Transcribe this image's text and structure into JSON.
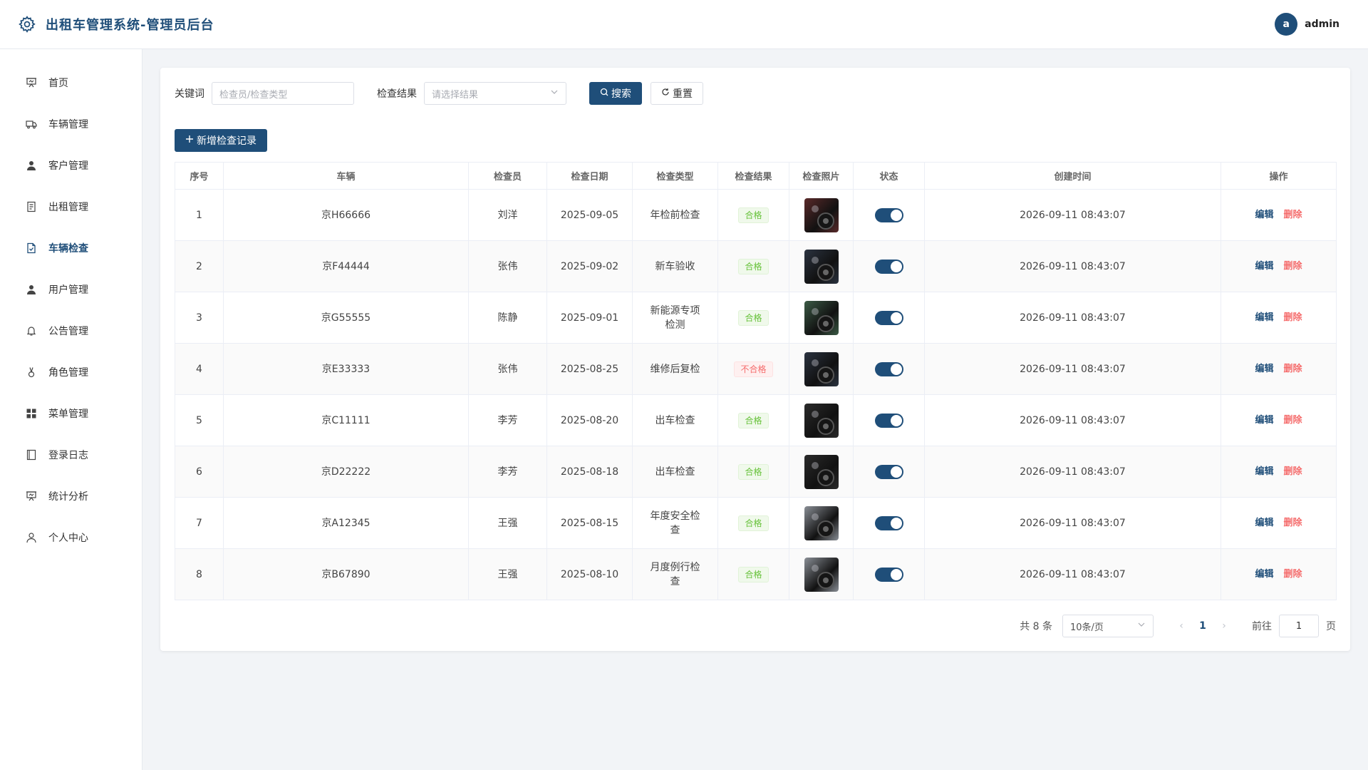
{
  "app": {
    "title": "出租车管理系统-管理员后台",
    "user_initial": "a",
    "username": "admin"
  },
  "sidebar": {
    "items": [
      {
        "label": "首页",
        "icon": "presentation-icon",
        "active": false
      },
      {
        "label": "车辆管理",
        "icon": "truck-icon",
        "active": false
      },
      {
        "label": "客户管理",
        "icon": "user-filled-icon",
        "active": false
      },
      {
        "label": "出租管理",
        "icon": "document-icon",
        "active": false
      },
      {
        "label": "车辆检查",
        "icon": "document-checked-icon",
        "active": true
      },
      {
        "label": "用户管理",
        "icon": "user-filled-icon",
        "active": false
      },
      {
        "label": "公告管理",
        "icon": "bell-icon",
        "active": false
      },
      {
        "label": "角色管理",
        "icon": "medal-icon",
        "active": false
      },
      {
        "label": "菜单管理",
        "icon": "grid-icon",
        "active": false
      },
      {
        "label": "登录日志",
        "icon": "notebook-icon",
        "active": false
      },
      {
        "label": "统计分析",
        "icon": "presentation-icon",
        "active": false
      },
      {
        "label": "个人中心",
        "icon": "user-outline-icon",
        "active": false
      }
    ]
  },
  "filters": {
    "keyword_label": "关键词",
    "keyword_placeholder": "检查员/检查类型",
    "result_label": "检查结果",
    "result_placeholder": "请选择结果",
    "search_label": "搜索",
    "reset_label": "重置",
    "add_label": "新增检查记录"
  },
  "table": {
    "headers": [
      "序号",
      "车辆",
      "检查员",
      "检查日期",
      "检查类型",
      "检查结果",
      "检查照片",
      "状态",
      "创建时间",
      "操作"
    ],
    "rows": [
      {
        "no": "1",
        "vehicle": "京H66666",
        "inspector": "刘洋",
        "date": "2025-09-05",
        "type": "年检前检查",
        "result": "合格",
        "result_ok": true,
        "photo_color": "#5a2a2a",
        "status_on": true,
        "created": "2026-09-11 08:43:07"
      },
      {
        "no": "2",
        "vehicle": "京F44444",
        "inspector": "张伟",
        "date": "2025-09-02",
        "type": "新车验收",
        "result": "合格",
        "result_ok": true,
        "photo_color": "#2b3340",
        "status_on": true,
        "created": "2026-09-11 08:43:07"
      },
      {
        "no": "3",
        "vehicle": "京G55555",
        "inspector": "陈静",
        "date": "2025-09-01",
        "type": "新能源专项检测",
        "result": "合格",
        "result_ok": true,
        "photo_color": "#3b5a45",
        "status_on": true,
        "created": "2026-09-11 08:43:07"
      },
      {
        "no": "4",
        "vehicle": "京E33333",
        "inspector": "张伟",
        "date": "2025-08-25",
        "type": "维修后复检",
        "result": "不合格",
        "result_ok": false,
        "photo_color": "#2b3340",
        "status_on": true,
        "created": "2026-09-11 08:43:07"
      },
      {
        "no": "5",
        "vehicle": "京C11111",
        "inspector": "李芳",
        "date": "2025-08-20",
        "type": "出车检查",
        "result": "合格",
        "result_ok": true,
        "photo_color": "#2a2a2a",
        "status_on": true,
        "created": "2026-09-11 08:43:07"
      },
      {
        "no": "6",
        "vehicle": "京D22222",
        "inspector": "李芳",
        "date": "2025-08-18",
        "type": "出车检查",
        "result": "合格",
        "result_ok": true,
        "photo_color": "#2a2a2a",
        "status_on": true,
        "created": "2026-09-11 08:43:07"
      },
      {
        "no": "7",
        "vehicle": "京A12345",
        "inspector": "王强",
        "date": "2025-08-15",
        "type": "年度安全检查",
        "result": "合格",
        "result_ok": true,
        "photo_color": "#8a8f96",
        "status_on": true,
        "created": "2026-09-11 08:43:07"
      },
      {
        "no": "8",
        "vehicle": "京B67890",
        "inspector": "王强",
        "date": "2025-08-10",
        "type": "月度例行检查",
        "result": "合格",
        "result_ok": true,
        "photo_color": "#8a8f96",
        "status_on": true,
        "created": "2026-09-11 08:43:07"
      }
    ],
    "edit_label": "编辑",
    "delete_label": "删除"
  },
  "pagination": {
    "total_text": "共 8 条",
    "page_size": "10条/页",
    "current_page": "1",
    "goto_label": "前往",
    "goto_value": "1",
    "page_suffix": "页"
  }
}
